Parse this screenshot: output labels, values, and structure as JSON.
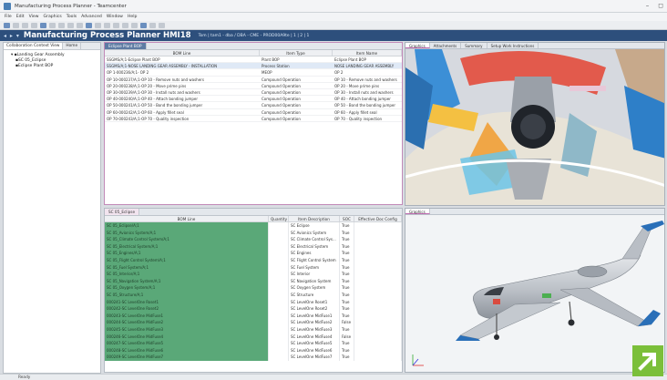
{
  "window": {
    "title": "Manufacturing Process Planner - Teamcenter"
  },
  "menu": [
    "File",
    "Edit",
    "View",
    "Graphics",
    "Tools",
    "Advanced",
    "Window",
    "Help"
  ],
  "app_header": {
    "title": "Manufacturing Process Planner HMI18",
    "info": "Tom | tam1 - dba / DBA - CME - PROD00A9te | 1 | 2 | 1"
  },
  "left_pane": {
    "tabs": [
      "Collaboration Context View",
      "Home"
    ],
    "tree": [
      {
        "label": "Landing Gear Assembly",
        "level": 1
      },
      {
        "label": "SC 05_Eclipse",
        "level": 2
      },
      {
        "label": "Eclipse Plant BOP",
        "level": 2
      }
    ]
  },
  "bop_panel": {
    "tab": "Eclipse Plant BOP",
    "columns": [
      "BOM Line",
      "Item Type",
      "Item Name"
    ],
    "rows": [
      {
        "line": "SSGMS/A;1-Eclipse Plant BOP",
        "type": "Plant BOP",
        "name": "Eclipse Plant BOP"
      },
      {
        "line": "SSGMS/A;1-NOSE LANDING GEAR ASSEMBLY - INSTALLATION",
        "type": "Process Station",
        "name": "NOSE LANDING GEAR ASSEMBLY"
      },
      {
        "line": "OP 1-000236/A;1- OP 2",
        "type": "MEOP",
        "name": "OP 2"
      },
      {
        "line": "OP 10-000237/A;1-OP 10 - Remove nuts and washers",
        "type": "Compound Operation",
        "name": "OP 10 - Remove nuts and washers"
      },
      {
        "line": "OP 20-000238/A;1-OP 20 - Move prime pins",
        "type": "Compound Operation",
        "name": "OP 20 - Move prime pins"
      },
      {
        "line": "OP 30-000239/A;1-OP 30 - Install nuts and washers",
        "type": "Compound Operation",
        "name": "OP 30 - Install nuts and washers"
      },
      {
        "line": "OP 40-000240/A;1-OP 40 - Attach bonding jumper",
        "type": "Compound Operation",
        "name": "OP 40 - Attach bonding jumper"
      },
      {
        "line": "OP 50-000241/A;1-OP 50 - Bond the bonding jumper",
        "type": "Compound Operation",
        "name": "OP 50 - Bond the bonding jumper"
      },
      {
        "line": "OP 60-000242/A;1-OP 60 - Apply fillet seal",
        "type": "Compound Operation",
        "name": "OP 60 - Apply fillet seal"
      },
      {
        "line": "OP 70-000243/A;1-OP 70 - Quality inspection",
        "type": "Compound Operation",
        "name": "OP 70 - Quality inspection"
      }
    ]
  },
  "top_right": {
    "tabs": [
      "Graphics",
      "Attachments",
      "Summary",
      "Setup Work Instructions"
    ]
  },
  "bom_panel": {
    "tab": "SC 05_Eclipse",
    "columns": [
      "BOM Line",
      "Quantity",
      "Item Description",
      "SOC",
      "Effective Doc Config"
    ],
    "rows": [
      {
        "line": "SC 05_Eclipse/A;1",
        "desc": "SC Eclipse",
        "soc": "True"
      },
      {
        "line": "SC 05_Avionics System/A;1",
        "desc": "SC Avionics System",
        "soc": "True"
      },
      {
        "line": "SC 05_Climate Control System/A;1",
        "desc": "SC Climate Control Sys...",
        "soc": "True"
      },
      {
        "line": "SC 05_Electrical System/A;1",
        "desc": "SC Electrical System",
        "soc": "True"
      },
      {
        "line": "SC 05_Engines/A;1",
        "desc": "SC Engines",
        "soc": "True"
      },
      {
        "line": "SC 05_Flight Control System/A;1",
        "desc": "SC Flight Control System",
        "soc": "True"
      },
      {
        "line": "SC 05_Fuel System/A;1",
        "desc": "SC Fuel System",
        "soc": "True"
      },
      {
        "line": "SC 05_Interior/A;1",
        "desc": "SC Interior",
        "soc": "True"
      },
      {
        "line": "SC 05_Navigation System/A;1",
        "desc": "SC Navigation System",
        "soc": "True"
      },
      {
        "line": "SC 05_Oxygen System/A;1",
        "desc": "SC Oxygen System",
        "soc": "True"
      },
      {
        "line": "SC 05_Structure/A;1",
        "desc": "SC Structure",
        "soc": "True"
      },
      {
        "line": "000241-SC LevelOne Roset1",
        "desc": "SC LevelOne Roset1",
        "soc": "True"
      },
      {
        "line": "000242-SC LevelOne Roset2",
        "desc": "SC LevelOne Roset2",
        "soc": "True"
      },
      {
        "line": "000243-SC LevelOne MidFuse1",
        "desc": "SC LevelOne MidFuse1",
        "soc": "True"
      },
      {
        "line": "000244-SC LevelOne MidFuse2",
        "desc": "SC LevelOne MidFuse2",
        "soc": "False"
      },
      {
        "line": "000245-SC LevelOne MidFuse3",
        "desc": "SC LevelOne MidFuse3",
        "soc": "True"
      },
      {
        "line": "000246-SC LevelOne MidFuse4",
        "desc": "SC LevelOne MidFuse4",
        "soc": "False"
      },
      {
        "line": "000247-SC LevelOne MidFuse5",
        "desc": "SC LevelOne MidFuse5",
        "soc": "True"
      },
      {
        "line": "000248-SC LevelOne MidFuse6",
        "desc": "SC LevelOne MidFuse6",
        "soc": "True"
      },
      {
        "line": "000249-SC LevelOne MidFuse7",
        "desc": "SC LevelOne MidFuse7",
        "soc": "True"
      }
    ]
  },
  "bottom_right": {
    "tab": "Graphics"
  },
  "status": {
    "text": "Ready"
  },
  "colors": {
    "header_bg": "#2d4f7c",
    "bom_green": "#5aa878",
    "badge_green": "#7bbf3a"
  }
}
